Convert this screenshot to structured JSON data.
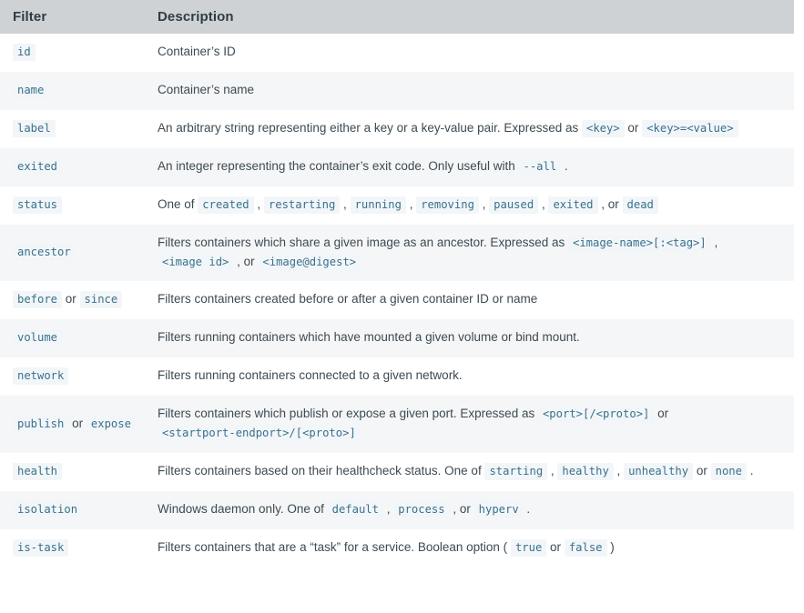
{
  "table": {
    "headers": {
      "filter": "Filter",
      "description": "Description"
    },
    "colors": {
      "header_bg": "#ced2d5",
      "row_alt_bg": "#f5f6f7",
      "row_bg": "#ffffff",
      "code_bg": "#f3f6f8",
      "code_fg": "#37718e",
      "text_fg": "#3d4a52"
    },
    "rows": [
      {
        "filter_parts": [
          {
            "type": "code",
            "text": "id"
          }
        ],
        "desc_parts": [
          {
            "type": "text",
            "text": "Container’s ID"
          }
        ]
      },
      {
        "filter_parts": [
          {
            "type": "code",
            "text": "name"
          }
        ],
        "desc_parts": [
          {
            "type": "text",
            "text": "Container’s name"
          }
        ]
      },
      {
        "filter_parts": [
          {
            "type": "code",
            "text": "label"
          }
        ],
        "desc_parts": [
          {
            "type": "text",
            "text": "An arbitrary string representing either a key or a key-value pair. Expressed as "
          },
          {
            "type": "code",
            "text": "<key>"
          },
          {
            "type": "text",
            "text": " or "
          },
          {
            "type": "code",
            "text": "<key>=<value>"
          }
        ]
      },
      {
        "filter_parts": [
          {
            "type": "code",
            "text": "exited"
          }
        ],
        "desc_parts": [
          {
            "type": "text",
            "text": "An integer representing the container’s exit code. Only useful with "
          },
          {
            "type": "code",
            "text": "--all"
          },
          {
            "type": "text",
            "text": " ."
          }
        ]
      },
      {
        "filter_parts": [
          {
            "type": "code",
            "text": "status"
          }
        ],
        "desc_parts": [
          {
            "type": "text",
            "text": "One of "
          },
          {
            "type": "code",
            "text": "created"
          },
          {
            "type": "text",
            "text": " , "
          },
          {
            "type": "code",
            "text": "restarting"
          },
          {
            "type": "text",
            "text": " , "
          },
          {
            "type": "code",
            "text": "running"
          },
          {
            "type": "text",
            "text": " , "
          },
          {
            "type": "code",
            "text": "removing"
          },
          {
            "type": "text",
            "text": " , "
          },
          {
            "type": "code",
            "text": "paused"
          },
          {
            "type": "text",
            "text": " , "
          },
          {
            "type": "code",
            "text": "exited"
          },
          {
            "type": "text",
            "text": " , or "
          },
          {
            "type": "code",
            "text": "dead"
          }
        ]
      },
      {
        "filter_parts": [
          {
            "type": "code",
            "text": "ancestor"
          }
        ],
        "desc_parts": [
          {
            "type": "text",
            "text": "Filters containers which share a given image as an ancestor. Expressed as "
          },
          {
            "type": "code",
            "text": "<image-name>[:<tag>]"
          },
          {
            "type": "text",
            "text": " , "
          },
          {
            "type": "code",
            "text": "<image id>"
          },
          {
            "type": "text",
            "text": " , or "
          },
          {
            "type": "code",
            "text": "<image@digest>"
          }
        ]
      },
      {
        "filter_parts": [
          {
            "type": "code",
            "text": "before"
          },
          {
            "type": "text",
            "text": " or "
          },
          {
            "type": "code",
            "text": "since"
          }
        ],
        "desc_parts": [
          {
            "type": "text",
            "text": "Filters containers created before or after a given container ID or name"
          }
        ]
      },
      {
        "filter_parts": [
          {
            "type": "code",
            "text": "volume"
          }
        ],
        "desc_parts": [
          {
            "type": "text",
            "text": "Filters running containers which have mounted a given volume or bind mount."
          }
        ]
      },
      {
        "filter_parts": [
          {
            "type": "code",
            "text": "network"
          }
        ],
        "desc_parts": [
          {
            "type": "text",
            "text": "Filters running containers connected to a given network."
          }
        ]
      },
      {
        "filter_parts": [
          {
            "type": "code",
            "text": "publish"
          },
          {
            "type": "text",
            "text": " or "
          },
          {
            "type": "code",
            "text": "expose"
          }
        ],
        "desc_parts": [
          {
            "type": "text",
            "text": "Filters containers which publish or expose a given port. Expressed as "
          },
          {
            "type": "code",
            "text": "<port>[/<proto>]"
          },
          {
            "type": "text",
            "text": " or "
          },
          {
            "type": "code",
            "text": "<startport-endport>/[<proto>]"
          }
        ]
      },
      {
        "filter_parts": [
          {
            "type": "code",
            "text": "health"
          }
        ],
        "desc_parts": [
          {
            "type": "text",
            "text": "Filters containers based on their healthcheck status. One of "
          },
          {
            "type": "code",
            "text": "starting"
          },
          {
            "type": "text",
            "text": " , "
          },
          {
            "type": "code",
            "text": "healthy"
          },
          {
            "type": "text",
            "text": " , "
          },
          {
            "type": "code",
            "text": "unhealthy"
          },
          {
            "type": "text",
            "text": " or "
          },
          {
            "type": "code",
            "text": "none"
          },
          {
            "type": "text",
            "text": " ."
          }
        ]
      },
      {
        "filter_parts": [
          {
            "type": "code",
            "text": "isolation"
          }
        ],
        "desc_parts": [
          {
            "type": "text",
            "text": "Windows daemon only. One of "
          },
          {
            "type": "code",
            "text": "default"
          },
          {
            "type": "text",
            "text": " , "
          },
          {
            "type": "code",
            "text": "process"
          },
          {
            "type": "text",
            "text": " , or "
          },
          {
            "type": "code",
            "text": "hyperv"
          },
          {
            "type": "text",
            "text": " ."
          }
        ]
      },
      {
        "filter_parts": [
          {
            "type": "code",
            "text": "is-task"
          }
        ],
        "desc_parts": [
          {
            "type": "text",
            "text": "Filters containers that are a “task” for a service. Boolean option ( "
          },
          {
            "type": "code",
            "text": "true"
          },
          {
            "type": "text",
            "text": " or "
          },
          {
            "type": "code",
            "text": "false"
          },
          {
            "type": "text",
            "text": " )"
          }
        ]
      }
    ]
  }
}
